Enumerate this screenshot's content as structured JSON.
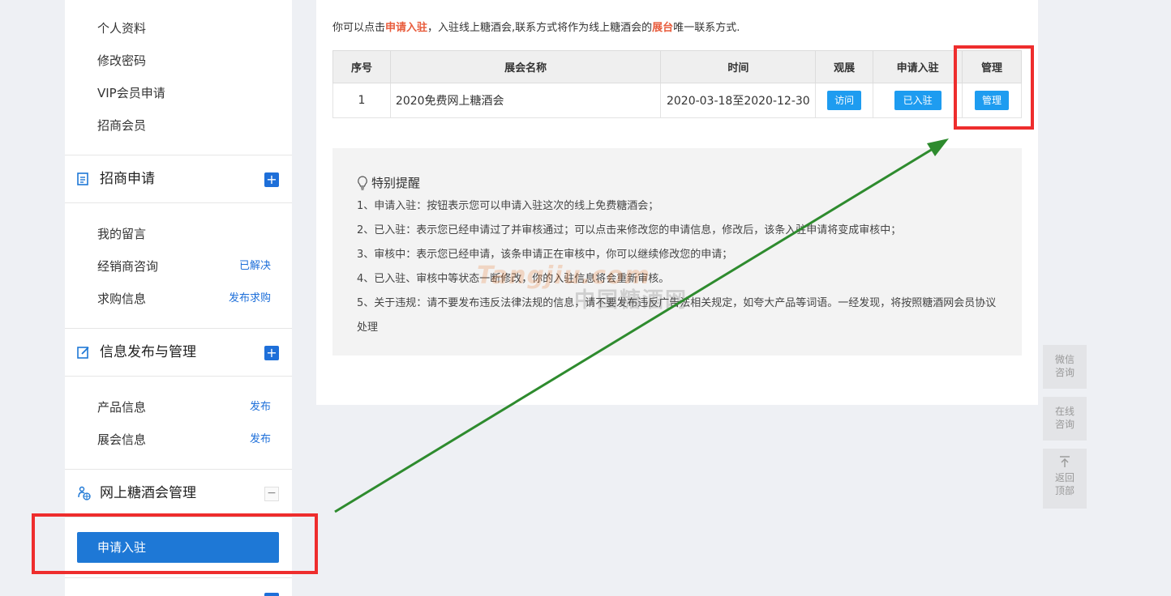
{
  "sidebar": {
    "profile_items": [
      "个人资料",
      "修改密码",
      "VIP会员申请",
      "招商会员"
    ],
    "sections": [
      {
        "title": "招商申请",
        "toggle": "+",
        "items": [
          {
            "label": "我的留言",
            "action": ""
          },
          {
            "label": "经销商咨询",
            "action": "已解决"
          },
          {
            "label": "求购信息",
            "action": "发布求购"
          }
        ]
      },
      {
        "title": "信息发布与管理",
        "toggle": "+",
        "items": [
          {
            "label": "产品信息",
            "action": "发布"
          },
          {
            "label": "展会信息",
            "action": "发布"
          }
        ]
      },
      {
        "title": "网上糖酒会管理",
        "toggle": "−",
        "items": [
          {
            "label": "申请入驻",
            "action": ""
          }
        ]
      }
    ]
  },
  "notice": {
    "part1": "你可以点击",
    "link1": "申请入驻",
    "part2": "，入驻线上糖酒会,联系方式将作为线上糖酒会的",
    "link2": "展台",
    "part3": "唯一联系方式."
  },
  "table": {
    "headers": [
      "序号",
      "展会名称",
      "时间",
      "观展",
      "申请入驻",
      "管理"
    ],
    "rows": [
      {
        "no": "1",
        "name": "2020免费网上糖酒会",
        "time": "2020-03-18至2020-12-30",
        "view": "访问",
        "apply": "已入驻",
        "manage": "管理"
      }
    ]
  },
  "reminder": {
    "title": "特别提醒",
    "items": [
      "1、申请入驻：按钮表示您可以申请入驻这次的线上免费糖酒会；",
      "2、已入驻：表示您已经申请过了并审核通过；可以点击来修改您的申请信息，修改后，该条入驻申请将变成审核中；",
      "3、审核中：表示您已经申请，该条申请正在审核中，你可以继续修改您的申请；",
      "4、已入驻、审核中等状态一断修改，你的入驻信息将会重新审核。",
      "5、关于违规：请不要发布违反法律法规的信息，请不要发布违反广告法相关规定，如夸大产品等词语。一经发现，将按照糖酒网会员协议处理"
    ],
    "watermark_logo": "Tangjiu.com",
    "watermark_name": "中国糖酒网"
  },
  "float_tools": [
    {
      "label": "微信\n咨询",
      "icon": ""
    },
    {
      "label": "在线\n咨询",
      "icon": ""
    },
    {
      "label": "返回\n顶部",
      "icon": "arrow-top-icon"
    }
  ],
  "colors": {
    "primary": "#1e78d6",
    "button": "#1e9cf0",
    "highlight": "#e85c3c",
    "annotation_red": "#ee2d2d",
    "annotation_arrow": "#2e8b2e"
  }
}
